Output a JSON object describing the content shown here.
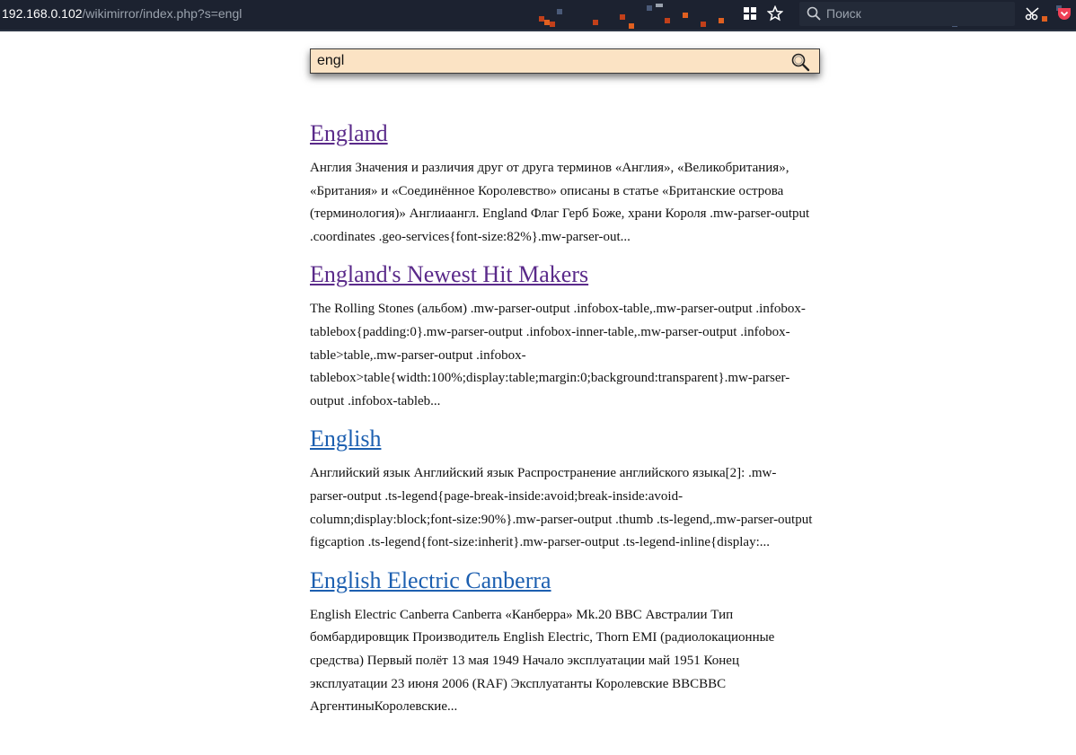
{
  "browser": {
    "url_host": "192.168.0.102",
    "url_path": "/wikimirror/index.php?s=engl",
    "search_placeholder": "Поиск",
    "icons": [
      "grid-icon",
      "star-icon",
      "search-icon",
      "scissors-icon",
      "pocket-icon"
    ]
  },
  "search": {
    "query": "engl",
    "button_icon": "magnifier-icon"
  },
  "results": [
    {
      "title": "England",
      "visited": true,
      "snippet": "Англия Значения и различия друг от друга терминов «Англия», «Великобритания», «Британия» и «Соединённое Королевство» описаны в статье «Британские острова (терминология)» Англиаангл. England Флаг Герб Боже, храни Короля .mw-parser-output .coordinates .geo-services{font-size:82%}.mw-parser-out..."
    },
    {
      "title": "England's Newest Hit Makers",
      "visited": true,
      "snippet": "The Rolling Stones (альбом) .mw-parser-output .infobox-table,.mw-parser-output .infobox-tablebox{padding:0}.mw-parser-output .infobox-inner-table,.mw-parser-output .infobox-table>table,.mw-parser-output .infobox-tablebox>table{width:100%;display:table;margin:0;background:transparent}.mw-parser-output .infobox-tableb..."
    },
    {
      "title": "English",
      "visited": false,
      "snippet": "Английский язык Английский язык Распространение английского языка[2]: .mw-parser-output .ts-legend{page-break-inside:avoid;break-inside:avoid-column;display:block;font-size:90%}.mw-parser-output .thumb .ts-legend,.mw-parser-output figcaption .ts-legend{font-size:inherit}.mw-parser-output .ts-legend-inline{display:..."
    },
    {
      "title": "English Electric Canberra",
      "visited": false,
      "snippet": "English Electric Canberra Canberra «Канберра» Mk.20 ВВС Австралии Тип бомбардировщик Производитель English Electric, Thorn EMI (радиолокационные средства) Первый полёт 13 мая 1949 Начало эксплуатации май 1951 Конец эксплуатации 23 июня 2006 (RAF) Эксплуатанты Королевские ВВСВВС АргентиныКоролевские..."
    }
  ]
}
